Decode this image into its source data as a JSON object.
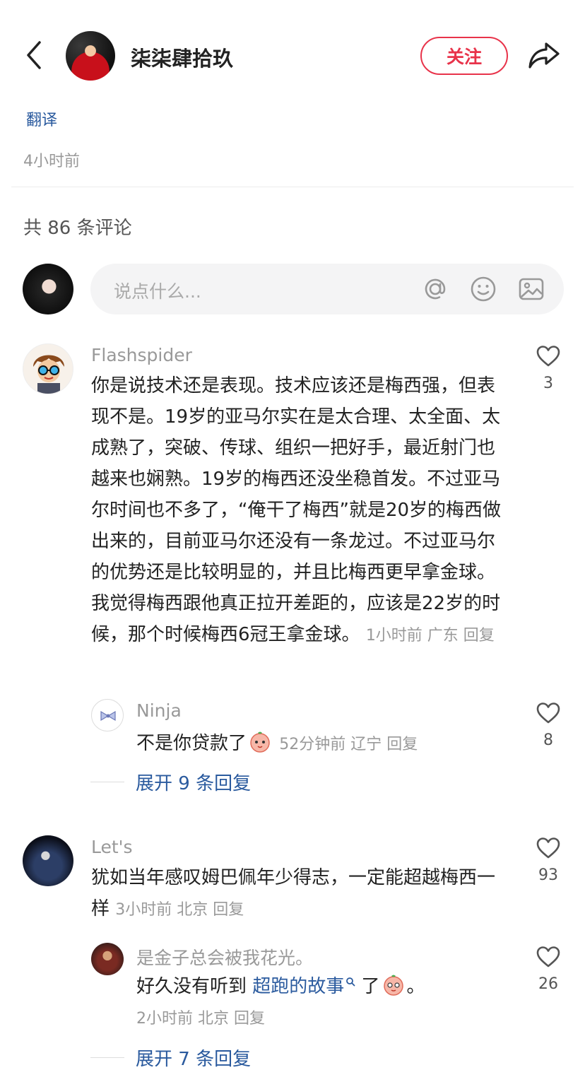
{
  "header": {
    "author_name": "柒柒肆拾玖",
    "follow_label": "关注"
  },
  "post": {
    "translate_label": "翻译",
    "time": "4小时前"
  },
  "comments_header": {
    "count_text": "共 86 条评论"
  },
  "composer": {
    "placeholder": "说点什么..."
  },
  "comments": [
    {
      "user": "Flashspider",
      "text": "你是说技术还是表现。技术应该还是梅西强，但表现不是。19岁的亚马尔实在是太合理、太全面、太成熟了，突破、传球、组织一把好手，最近射门也越来也娴熟。19岁的梅西还没坐稳首发。不过亚马尔时间也不多了，“俺干了梅西”就是20岁的梅西做出来的，目前亚马尔还没有一条龙过。不过亚马尔的优势还是比较明显的，并且比梅西更早拿金球。我觉得梅西跟他真正拉开差距的，应该是22岁的时候，那个时候梅西6冠王拿金球。",
      "meta": "1小时前 广东 回复",
      "likes": "3",
      "reply": {
        "user": "Ninja",
        "text": "不是你贷款了",
        "meta": "52分钟前 辽宁 回复",
        "likes": "8"
      },
      "expand_label": "展开 9 条回复"
    },
    {
      "user": "Let's",
      "text": "犹如当年感叹姆巴佩年少得志，一定能超越梅西一样",
      "meta": "3小时前 北京 回复",
      "likes": "93",
      "reply": {
        "user": "是金子总会被我花光。",
        "text_before": "好久没有听到 ",
        "link_text": "超跑的故事",
        "text_after": " 了",
        "text_end": "。",
        "meta": "2小时前 北京 回复",
        "likes": "26"
      },
      "expand_label": "展开 7 条回复"
    }
  ],
  "icons": {
    "back": "chevron-left-icon",
    "share": "share-arrow-icon",
    "at": "at-icon",
    "emoji": "smiley-icon",
    "image": "image-icon",
    "like": "heart-outline-icon"
  },
  "colors": {
    "accent_red": "#e8334a",
    "link_blue": "#2a5a9e",
    "meta_gray": "#999999",
    "input_bg": "#f4f4f5"
  }
}
